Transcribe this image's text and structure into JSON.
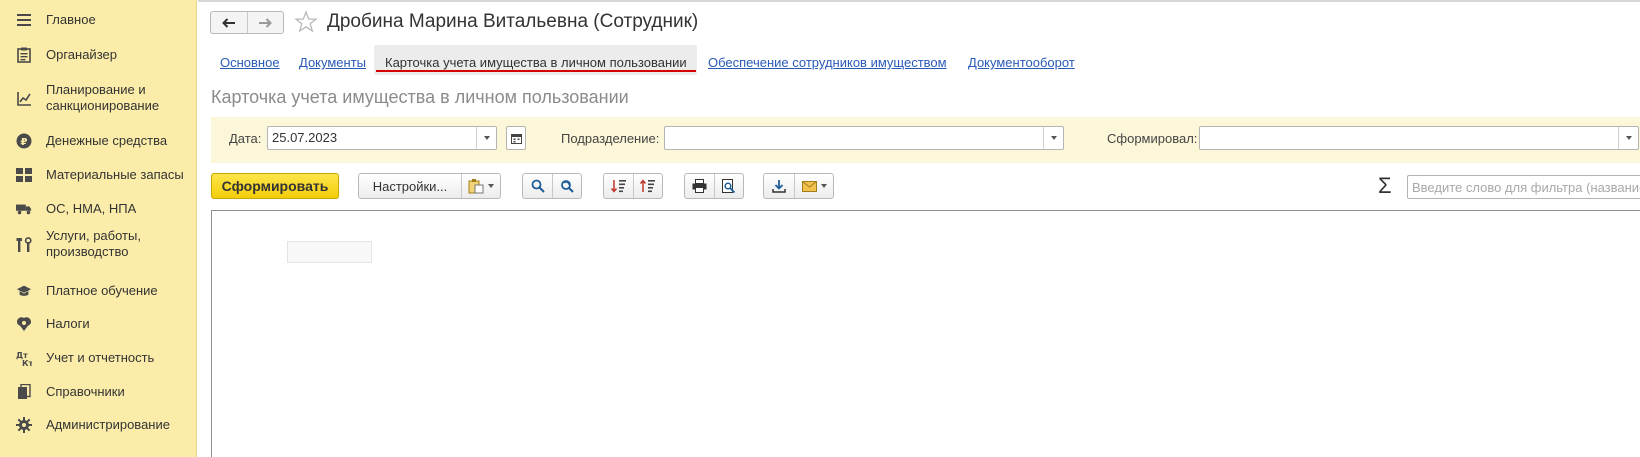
{
  "sidebar": {
    "items": [
      {
        "label": "Главное",
        "icon": "menu-icon"
      },
      {
        "label": "Органайзер",
        "icon": "clipboard-icon"
      },
      {
        "label": "Планирование и санкционирование",
        "icon": "planning-chart-icon"
      },
      {
        "label": "Денежные средства",
        "icon": "ruble-coin-icon"
      },
      {
        "label": "Материальные запасы",
        "icon": "inventory-grid-icon"
      },
      {
        "label": "ОС, НМА, НПА",
        "icon": "truck-icon"
      },
      {
        "label": "Услуги, работы, производство",
        "icon": "tools-icon"
      },
      {
        "label": "Платное обучение",
        "icon": "graduation-cap-icon"
      },
      {
        "label": "Налоги",
        "icon": "emblem-icon"
      },
      {
        "label": "Учет и отчетность",
        "icon": "debit-credit-icon"
      },
      {
        "label": "Справочники",
        "icon": "books-icon"
      },
      {
        "label": "Администрирование",
        "icon": "gear-icon"
      }
    ]
  },
  "header": {
    "title": "Дробина Марина Витальевна (Сотрудник)"
  },
  "tabs": [
    {
      "label": "Основное",
      "active": false
    },
    {
      "label": "Документы",
      "active": false
    },
    {
      "label": "Карточка учета имущества в личном пользовании",
      "active": true
    },
    {
      "label": "Обеспечение сотрудников имуществом",
      "active": false
    },
    {
      "label": "Документооборот",
      "active": false
    }
  ],
  "report": {
    "title": "Карточка учета имущества в личном пользовании"
  },
  "params": {
    "date_label": "Дата:",
    "date_value": "25.07.2023",
    "subdivision_label": "Подразделение:",
    "subdivision_value": "",
    "formed_by_label": "Сформировал:",
    "formed_by_value": ""
  },
  "toolbar": {
    "generate_label": "Сформировать",
    "settings_label": "Настройки...",
    "filter_placeholder": "Введите слово для фильтра (название"
  },
  "colors": {
    "sidebar_bg": "#fbeda9",
    "params_bg": "#fdf7d9",
    "primary_button": "#f9d72a",
    "link": "#2a5ab8",
    "active_tab_marker": "#d60000"
  }
}
